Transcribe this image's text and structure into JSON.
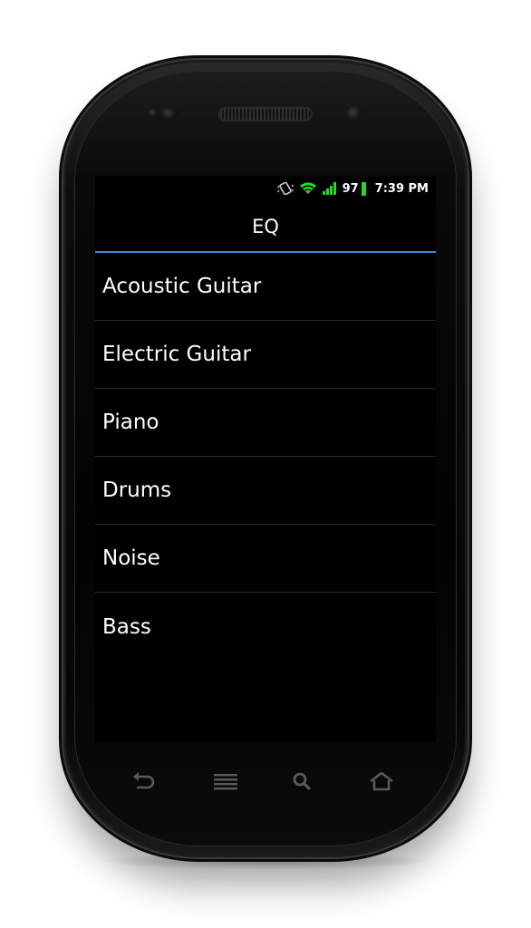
{
  "status_bar": {
    "battery_percent": "97",
    "time": "7:39 PM",
    "icons": [
      "vibrate-icon",
      "wifi-icon",
      "signal-icon",
      "battery-icon"
    ],
    "battery_color": "#2bd62b"
  },
  "header": {
    "title": "EQ",
    "accent_color": "#3a8dde"
  },
  "list": {
    "items": [
      {
        "label": "Acoustic Guitar"
      },
      {
        "label": "Electric Guitar"
      },
      {
        "label": "Piano"
      },
      {
        "label": "Drums"
      },
      {
        "label": "Noise"
      },
      {
        "label": "Bass"
      }
    ]
  },
  "nav_keys": [
    "back-icon",
    "menu-icon",
    "search-icon",
    "home-icon"
  ]
}
